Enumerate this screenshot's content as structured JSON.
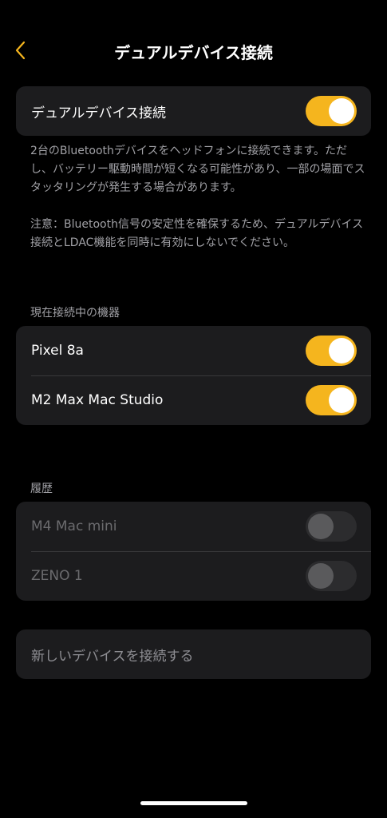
{
  "header": {
    "title": "デュアルデバイス接続",
    "back_icon": "chevron-left-icon",
    "accent_color": "#f5b51e"
  },
  "dual": {
    "label": "デュアルデバイス接続",
    "enabled": true,
    "description_1": "2台のBluetoothデバイスをヘッドフォンに接続できます。ただし、バッテリー駆動時間が短くなる可能性があり、一部の場面でスタッタリングが発生する場合があります。",
    "description_2": "注意：Bluetooth信号の安定性を確保するため、デュアルデバイス接続とLDAC機能を同時に有効にしないでください。"
  },
  "connected": {
    "header": "現在接続中の機器",
    "devices": [
      {
        "name": "Pixel 8a",
        "enabled": true
      },
      {
        "name": "M2 Max Mac Studio",
        "enabled": true
      }
    ]
  },
  "history": {
    "header": "履歴",
    "devices": [
      {
        "name": "M4 Mac mini",
        "enabled": false
      },
      {
        "name": "ZENO 1",
        "enabled": false
      }
    ]
  },
  "new_device": {
    "label": "新しいデバイスを接続する"
  }
}
